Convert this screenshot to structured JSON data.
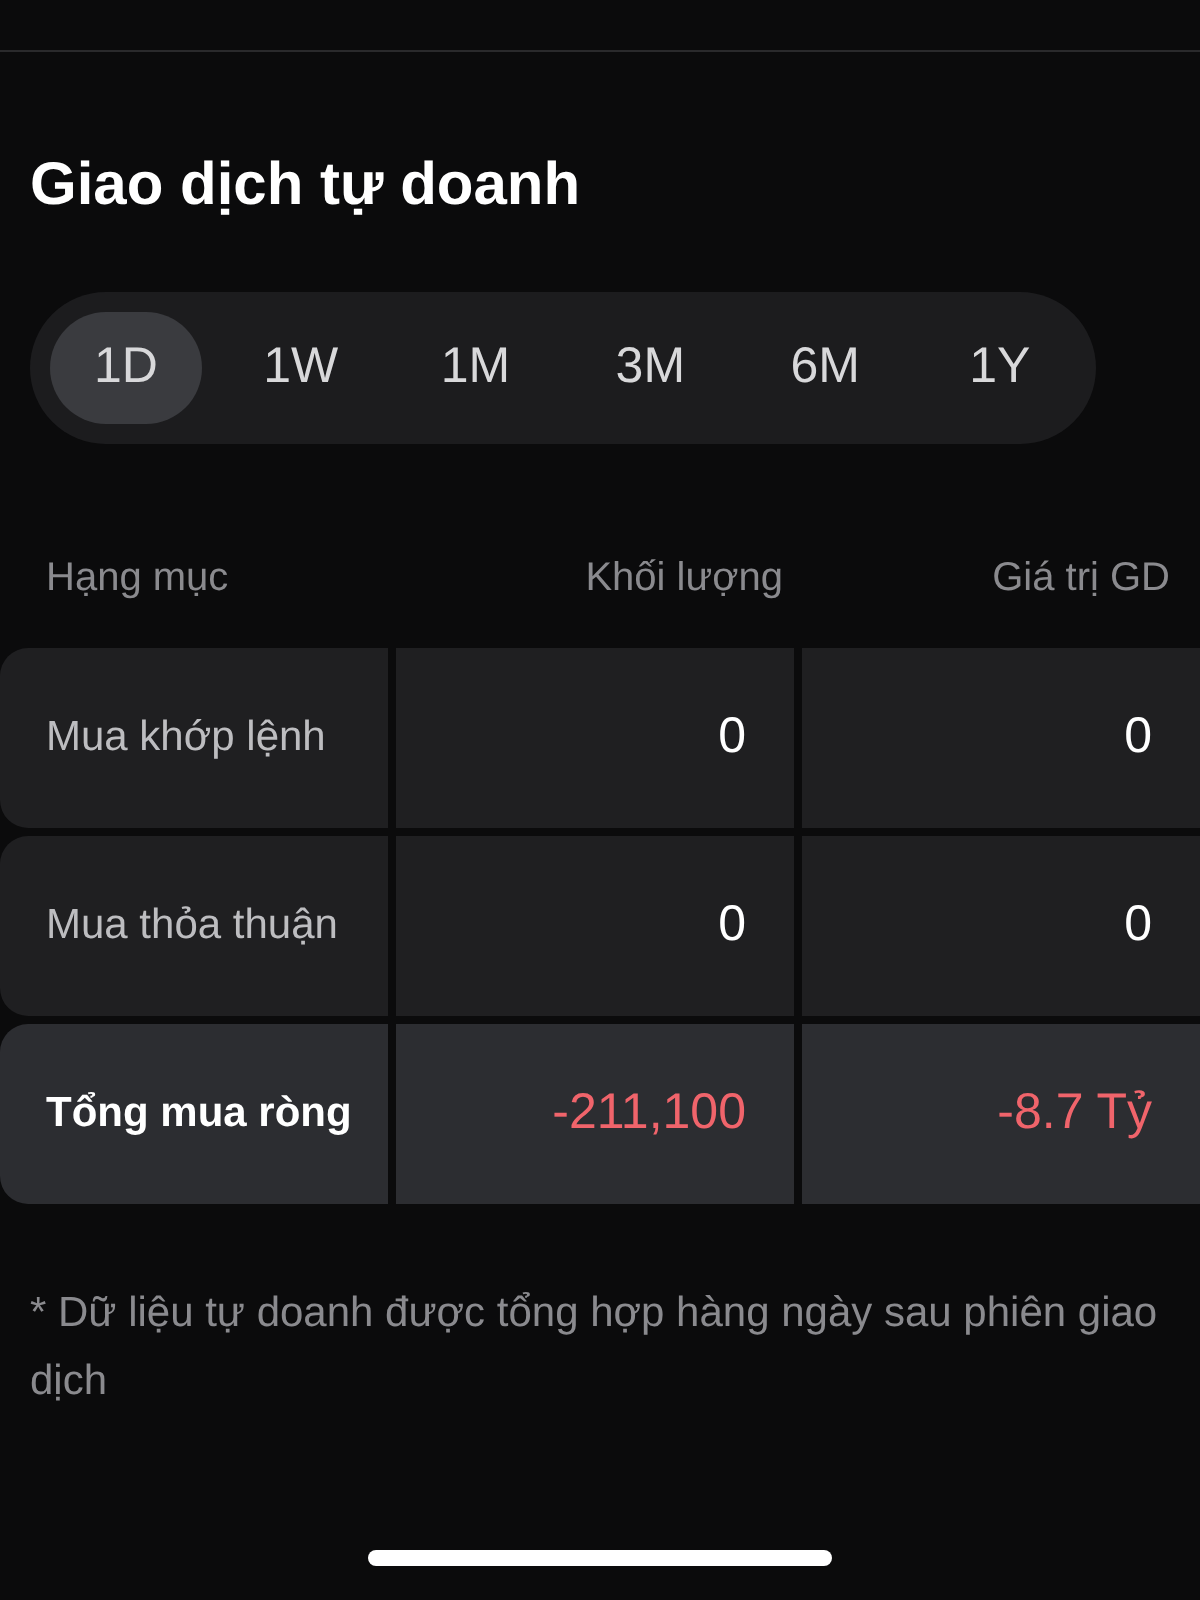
{
  "title": "Giao dịch tự doanh",
  "periods": [
    {
      "label": "1D",
      "selected": true
    },
    {
      "label": "1W",
      "selected": false
    },
    {
      "label": "1M",
      "selected": false
    },
    {
      "label": "3M",
      "selected": false
    },
    {
      "label": "6M",
      "selected": false
    },
    {
      "label": "1Y",
      "selected": false
    }
  ],
  "table": {
    "columns": [
      "Hạng mục",
      "Khối lượng",
      "Giá trị GD"
    ],
    "rows": [
      {
        "kind": "normal",
        "cells": [
          "Mua khớp lệnh",
          "0",
          "0"
        ]
      },
      {
        "kind": "normal",
        "cells": [
          "Mua thỏa thuận",
          "0",
          "0"
        ]
      },
      {
        "kind": "total",
        "cells": [
          "Tổng mua ròng",
          "-211,100",
          "-8.7 Tỷ"
        ]
      }
    ]
  },
  "footnote": "* Dữ liệu tự doanh được tổng hợp hàng ngày sau phiên giao dịch"
}
